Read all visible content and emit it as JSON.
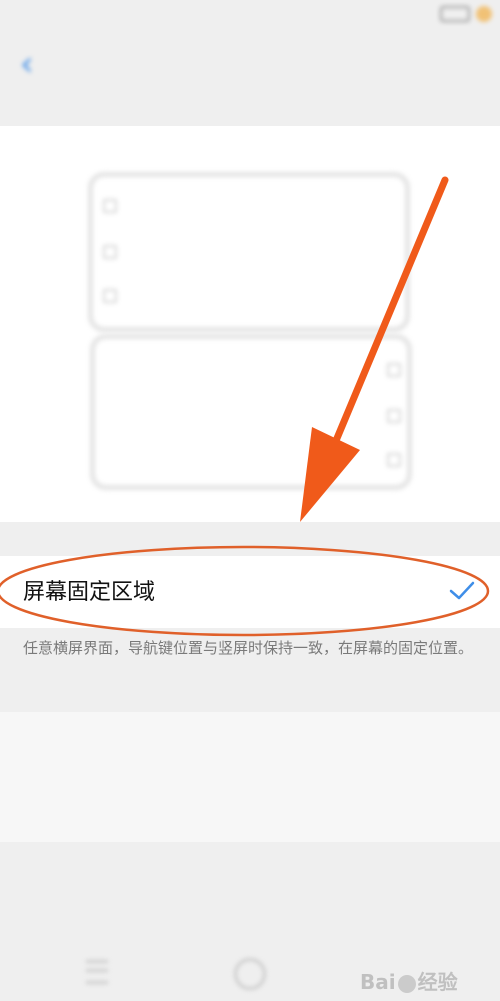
{
  "status_bar": {
    "left_text": "",
    "time": ""
  },
  "nav": {
    "title": ""
  },
  "option": {
    "label": "屏幕固定区域",
    "description": "任意横屏界面，导航键位置与竖屏时保持一致，在屏幕的固定位置。",
    "selected": true
  },
  "section2": {
    "heading": "",
    "description": ""
  },
  "colors": {
    "accent": "#3f8ee8",
    "annotation": "#f05a1a"
  },
  "icons": {
    "back": "back-arrow-icon",
    "check": "check-icon",
    "menu": "menu-icon",
    "home": "home-icon"
  },
  "watermark": {
    "text": "Bai du 经验"
  }
}
